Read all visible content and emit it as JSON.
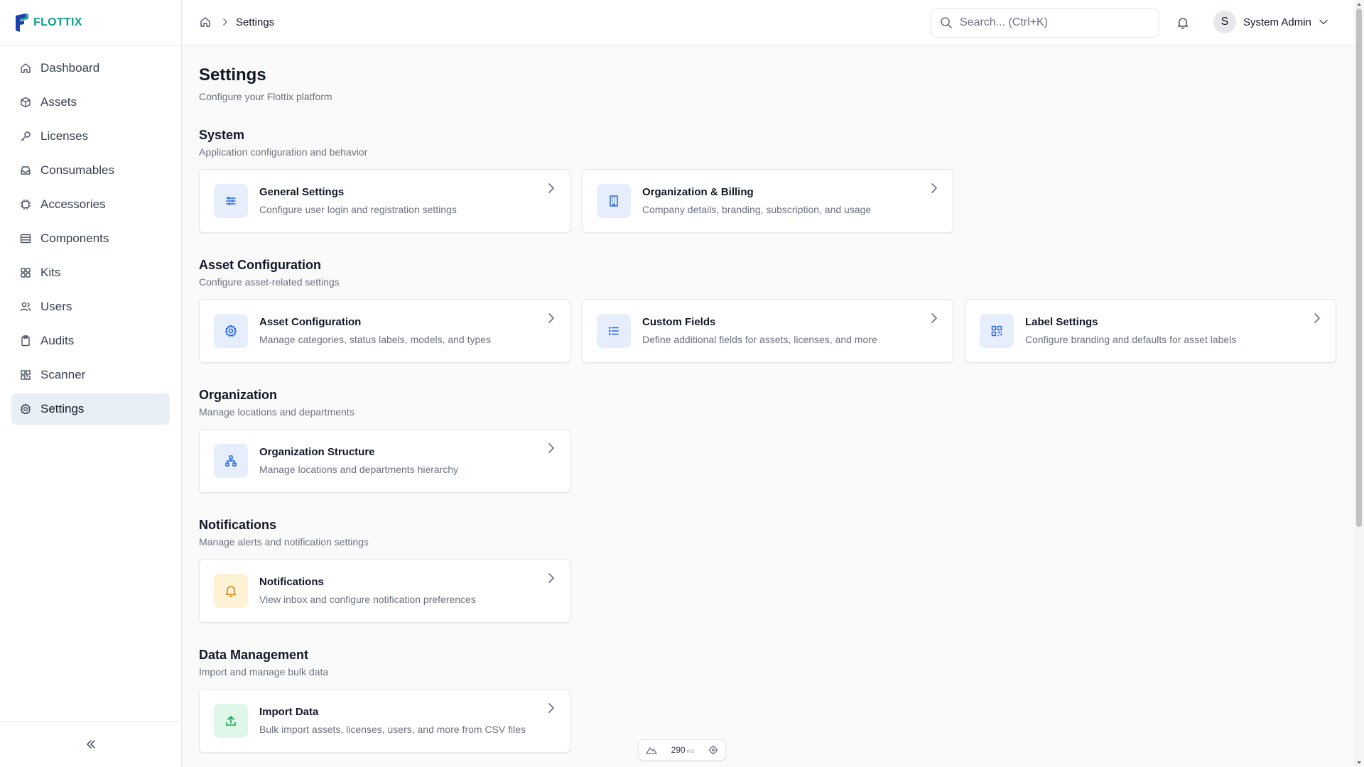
{
  "brand": {
    "name": "FLOTTIX",
    "primary_color": "#1e40af",
    "accent_color": "#0e9d8d"
  },
  "sidebar": {
    "items": [
      {
        "label": "Dashboard",
        "icon": "home-icon"
      },
      {
        "label": "Assets",
        "icon": "cube-icon"
      },
      {
        "label": "Licenses",
        "icon": "key-icon"
      },
      {
        "label": "Consumables",
        "icon": "inbox-icon"
      },
      {
        "label": "Accessories",
        "icon": "cpu-icon"
      },
      {
        "label": "Components",
        "icon": "server-icon"
      },
      {
        "label": "Kits",
        "icon": "grid-icon"
      },
      {
        "label": "Users",
        "icon": "users-icon"
      },
      {
        "label": "Audits",
        "icon": "clipboard-icon"
      },
      {
        "label": "Scanner",
        "icon": "qr-scan-icon"
      },
      {
        "label": "Settings",
        "icon": "gear-icon",
        "active": true
      }
    ],
    "collapse_icon": "chevrons-left-icon"
  },
  "header": {
    "breadcrumb": {
      "home_icon": "home-icon",
      "current": "Settings"
    },
    "search": {
      "placeholder": "Search... (Ctrl+K)",
      "value": ""
    },
    "notifications_icon": "bell-icon",
    "user": {
      "initial": "S",
      "name": "System Admin"
    }
  },
  "page": {
    "title": "Settings",
    "subtitle": "Configure your Flottix platform"
  },
  "sections": [
    {
      "title": "System",
      "description": "Application configuration and behavior",
      "cards": [
        {
          "title": "General Settings",
          "description": "Configure user login and registration settings",
          "icon": "sliders-icon",
          "tint": "#e6eefb"
        },
        {
          "title": "Organization & Billing",
          "description": "Company details, branding, subscription, and usage",
          "icon": "building-icon",
          "tint": "#e6eefb"
        }
      ]
    },
    {
      "title": "Asset Configuration",
      "description": "Configure asset-related settings",
      "cards": [
        {
          "title": "Asset Configuration",
          "description": "Manage categories, status labels, models, and types",
          "icon": "gear-icon",
          "tint": "#e6eefb"
        },
        {
          "title": "Custom Fields",
          "description": "Define additional fields for assets, licenses, and more",
          "icon": "list-icon",
          "tint": "#e6eefb"
        },
        {
          "title": "Label Settings",
          "description": "Configure branding and defaults for asset labels",
          "icon": "qr-code-icon",
          "tint": "#e6eefb"
        }
      ]
    },
    {
      "title": "Organization",
      "description": "Manage locations and departments",
      "cards": [
        {
          "title": "Organization Structure",
          "description": "Manage locations and departments hierarchy",
          "icon": "network-icon",
          "tint": "#e6eefb"
        }
      ]
    },
    {
      "title": "Notifications",
      "description": "Manage alerts and notification settings",
      "cards": [
        {
          "title": "Notifications",
          "description": "View inbox and configure notification preferences",
          "icon": "bell-icon",
          "tint": "#fdf3d4"
        }
      ]
    },
    {
      "title": "Data Management",
      "description": "Import and manage bulk data",
      "cards": [
        {
          "title": "Import Data",
          "description": "Bulk import assets, licenses, users, and more from CSV files",
          "icon": "upload-icon",
          "tint": "#def7e8"
        }
      ]
    }
  ],
  "dev_badge": {
    "value": "290",
    "unit": "ms"
  }
}
